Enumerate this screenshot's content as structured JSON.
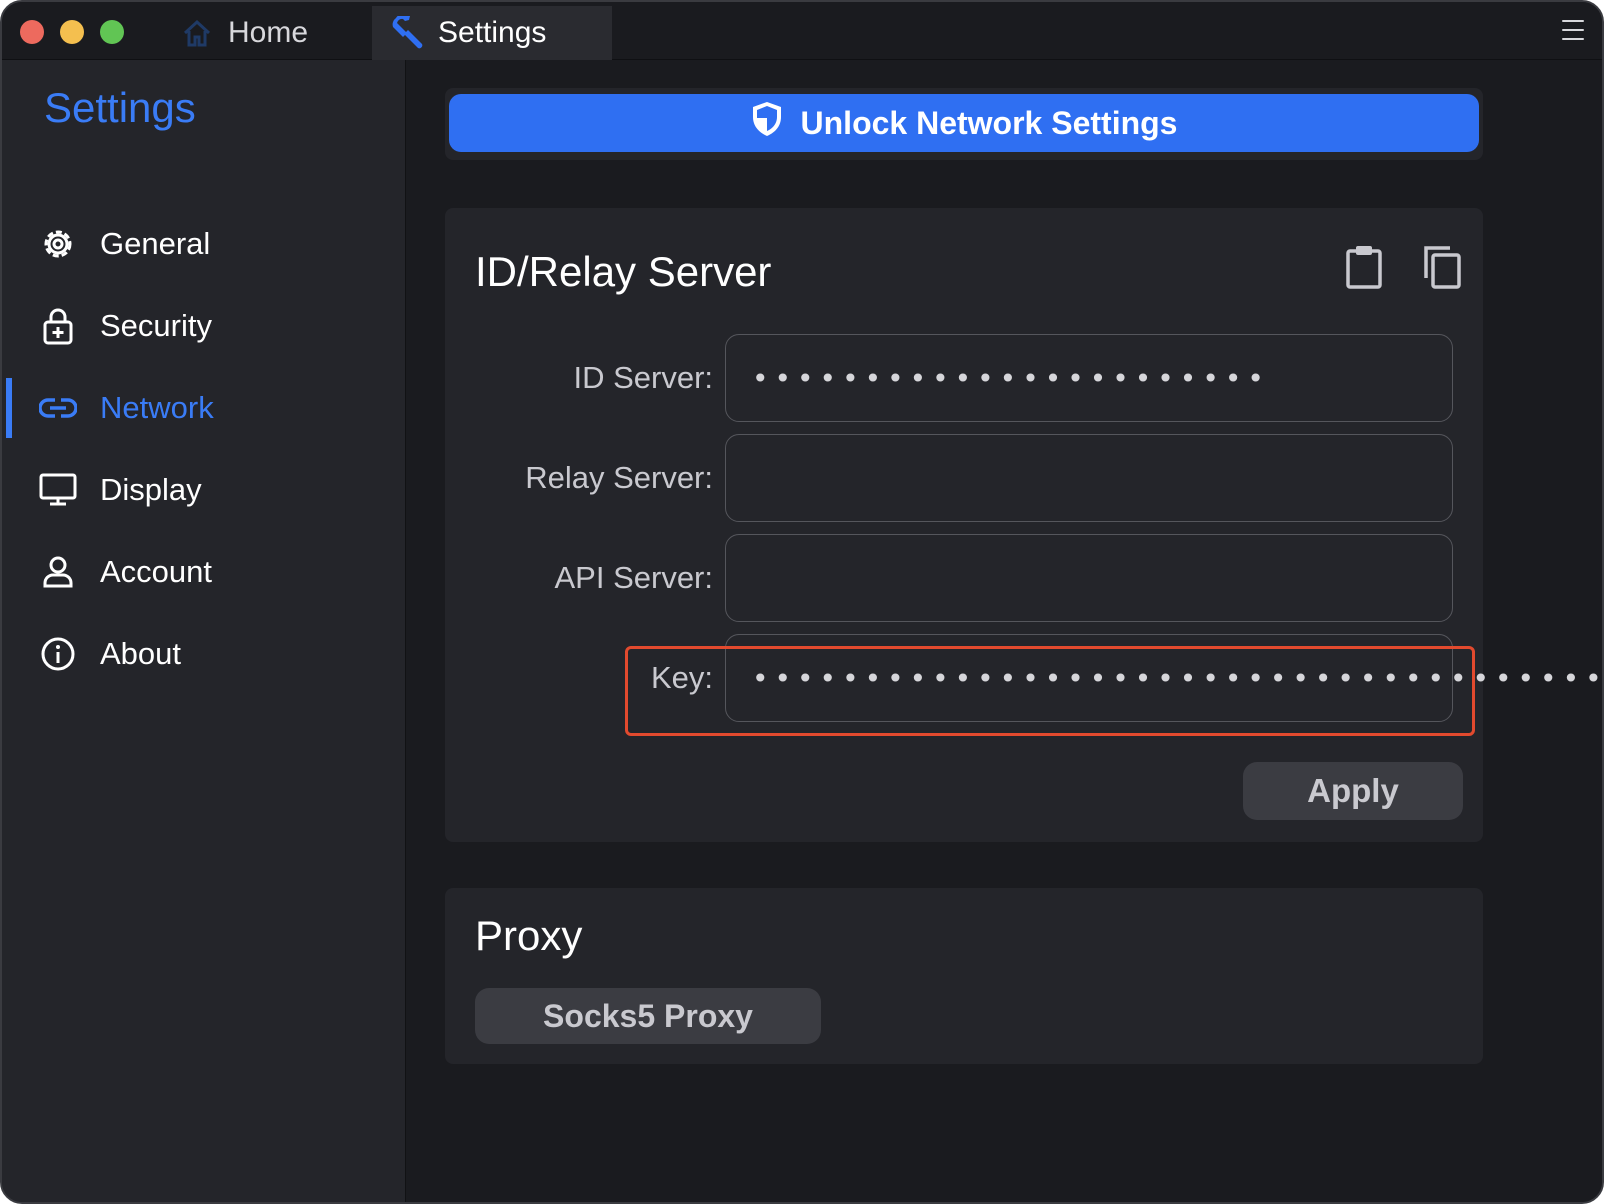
{
  "titlebar": {
    "tabs": [
      {
        "label": "Home",
        "icon": "home-icon",
        "active": false
      },
      {
        "label": "Settings",
        "icon": "wrench-icon",
        "active": true
      }
    ]
  },
  "sidebar": {
    "title": "Settings",
    "items": [
      {
        "label": "General",
        "icon": "gear-icon"
      },
      {
        "label": "Security",
        "icon": "lock-icon"
      },
      {
        "label": "Network",
        "icon": "link-icon",
        "active": true
      },
      {
        "label": "Display",
        "icon": "monitor-icon"
      },
      {
        "label": "Account",
        "icon": "user-icon"
      },
      {
        "label": "About",
        "icon": "info-icon"
      }
    ]
  },
  "unlock": {
    "label": "Unlock Network Settings",
    "icon": "shield-icon"
  },
  "relay": {
    "title": "ID/Relay Server",
    "fields": [
      {
        "label": "ID Server:",
        "value": "•••••••••••••••••••••••"
      },
      {
        "label": "Relay Server:",
        "value": ""
      },
      {
        "label": "API Server:",
        "value": ""
      },
      {
        "label": "Key:",
        "value": "••••••••••••••••••••••••••••••••••••••••••••"
      }
    ],
    "apply_label": "Apply"
  },
  "proxy": {
    "title": "Proxy",
    "socks_label": "Socks5 Proxy"
  },
  "colors": {
    "accent": "#3a7cf6",
    "button_blue": "#2f6ff2",
    "highlight": "#e24a2e",
    "background": "#1a1b1f",
    "panel": "#24252a"
  }
}
